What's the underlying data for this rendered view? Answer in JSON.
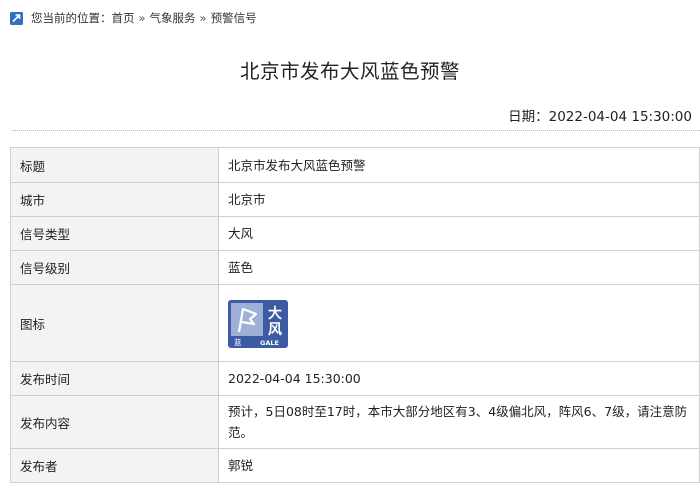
{
  "breadcrumb": {
    "prefix": "您当前的位置：",
    "items": [
      "首页",
      "气象服务",
      "预警信号"
    ],
    "separator": "»"
  },
  "page_title": "北京市发布大风蓝色预警",
  "date": {
    "label": "日期：",
    "value": "2022-04-04 15:30:00"
  },
  "table": {
    "rows": [
      {
        "key": "标题",
        "value": "北京市发布大风蓝色预警"
      },
      {
        "key": "城市",
        "value": "北京市"
      },
      {
        "key": "信号类型",
        "value": "大风"
      },
      {
        "key": "信号级别",
        "value": "蓝色"
      },
      {
        "key": "图标",
        "icon": "gale-blue-warning-icon"
      },
      {
        "key": "发布时间",
        "value": "2022-04-04 15:30:00"
      },
      {
        "key": "发布内容",
        "value": "预计，5日08时至17时，本市大部分地区有3、4级偏北风，阵风6、7级，请注意防范。"
      },
      {
        "key": "发布者",
        "value": "郭锐"
      }
    ]
  },
  "gale_icon": {
    "char_top": "大",
    "char_bottom": "风",
    "level_char": "蓝",
    "english": "GALE",
    "color": "#3d5aa5"
  },
  "colors": {
    "breadcrumb_icon": "#2f6fc0",
    "key_cell_bg": "#f3f3f3",
    "border": "#cfcfcf"
  }
}
